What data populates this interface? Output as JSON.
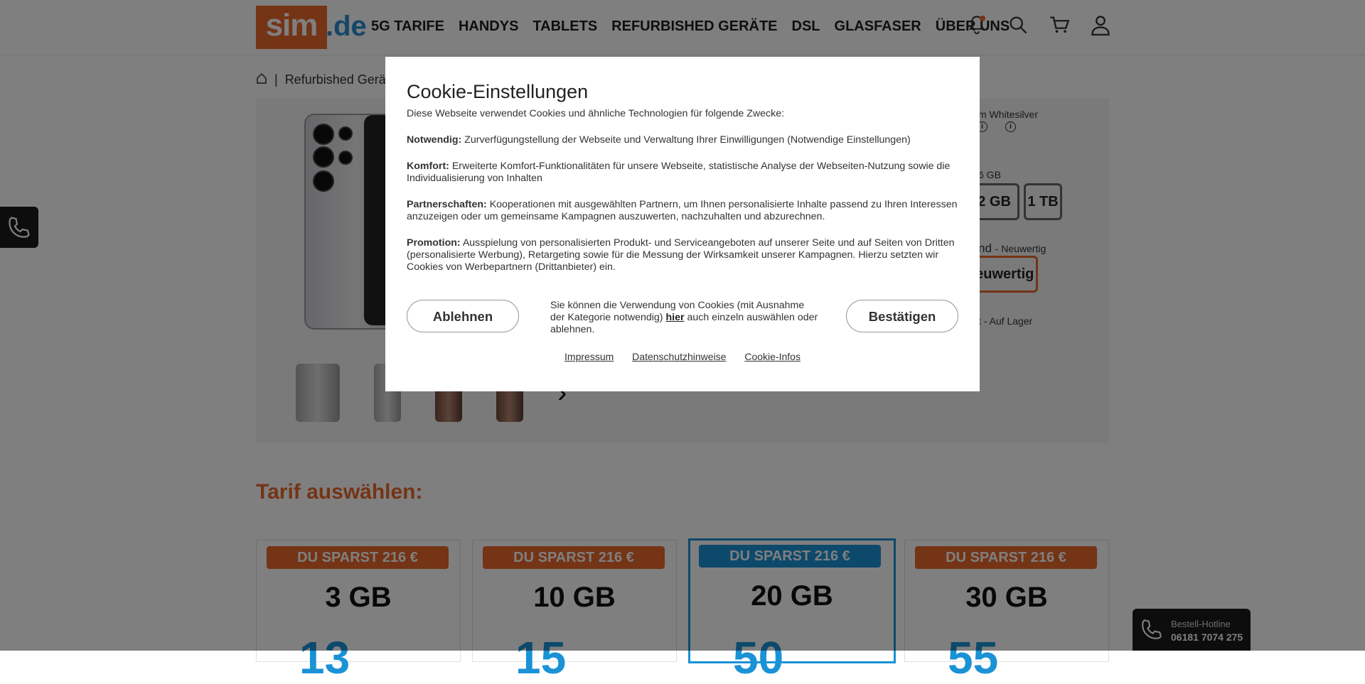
{
  "header": {
    "logo_sim": "sim",
    "logo_de": ".de",
    "nav": [
      "5G TARIFE",
      "HANDYS",
      "TABLETS",
      "REFURBISHED GERÄTE",
      "DSL",
      "GLASFASER",
      "ÜBER UNS"
    ],
    "icons": [
      "bell-icon",
      "search-icon",
      "cart-icon",
      "user-icon"
    ]
  },
  "breadcrumb": {
    "separator": "|",
    "current": "Refurbished Gerä"
  },
  "product": {
    "color_partial": "m Whitesilver",
    "storage_partial": "6 GB",
    "storage_options": [
      "12 GB",
      "1 TB"
    ],
    "condition_partial": "nd",
    "condition_label": "- Neuwertig",
    "condition_selected": "Neuwertig",
    "stock_partial": "t",
    "stock_label": "- Auf Lager"
  },
  "tarif": {
    "title": "Tarif auswählen:",
    "cards": [
      {
        "badge": "DU SPARST 216 €",
        "volume": "3 GB",
        "price_peek": "13"
      },
      {
        "badge": "DU SPARST 216 €",
        "volume": "10 GB",
        "price_peek": "15"
      },
      {
        "badge": "DU SPARST 216 €",
        "volume": "20 GB",
        "price_peek": "50"
      },
      {
        "badge": "DU SPARST 216 €",
        "volume": "30 GB",
        "price_peek": "55"
      }
    ]
  },
  "hotline": {
    "label": "Bestell-Hotline",
    "number": "06181 7074 275"
  },
  "cookie": {
    "title": "Cookie-Einstellungen",
    "intro": "Diese Webseite verwendet Cookies und ähnliche Technologien für folgende Zwecke:",
    "sections": [
      {
        "label": "Notwendig:",
        "text": "Zurverfügungstellung der Webseite und Verwaltung Ihrer Einwilligungen (Notwendige Einstellungen)"
      },
      {
        "label": "Komfort:",
        "text": "Erweiterte Komfort-Funktionalitäten für unsere Webseite, statistische Analyse der Webseiten-Nutzung sowie die Individualisierung von Inhalten"
      },
      {
        "label": "Partnerschaften:",
        "text": "Kooperationen mit ausgewählten Partnern, um Ihnen personalisierte Inhalte passend zu Ihren Interessen anzuzeigen oder um gemeinsame Kampagnen auszuwerten, nachzuhalten und abzurechnen."
      },
      {
        "label": "Promotion:",
        "text": "Ausspielung von personalisierten Produkt- und Serviceangeboten auf unserer Seite und auf Seiten von Dritten (personalisierte Werbung), Retargeting sowie für die Messung der Wirksamkeit unserer Kampagnen. Hierzu setzten wir Cookies von Werbepartnern (Drittanbieter) ein."
      }
    ],
    "decline_label": "Ablehnen",
    "confirm_label": "Bestätigen",
    "note_before": "Sie können die Verwendung von Cookies (mit Ausnahme der Kategorie notwendig)",
    "note_link": "hier",
    "note_after": "auch einzeln auswählen oder ablehnen.",
    "links": [
      "Impressum",
      "Datenschutzhinweise",
      "Cookie-Infos"
    ]
  },
  "colors": {
    "brand_orange": "#e8692a",
    "brand_blue": "#1a92d6",
    "overlay": "rgba(0,0,0,0.5)"
  }
}
